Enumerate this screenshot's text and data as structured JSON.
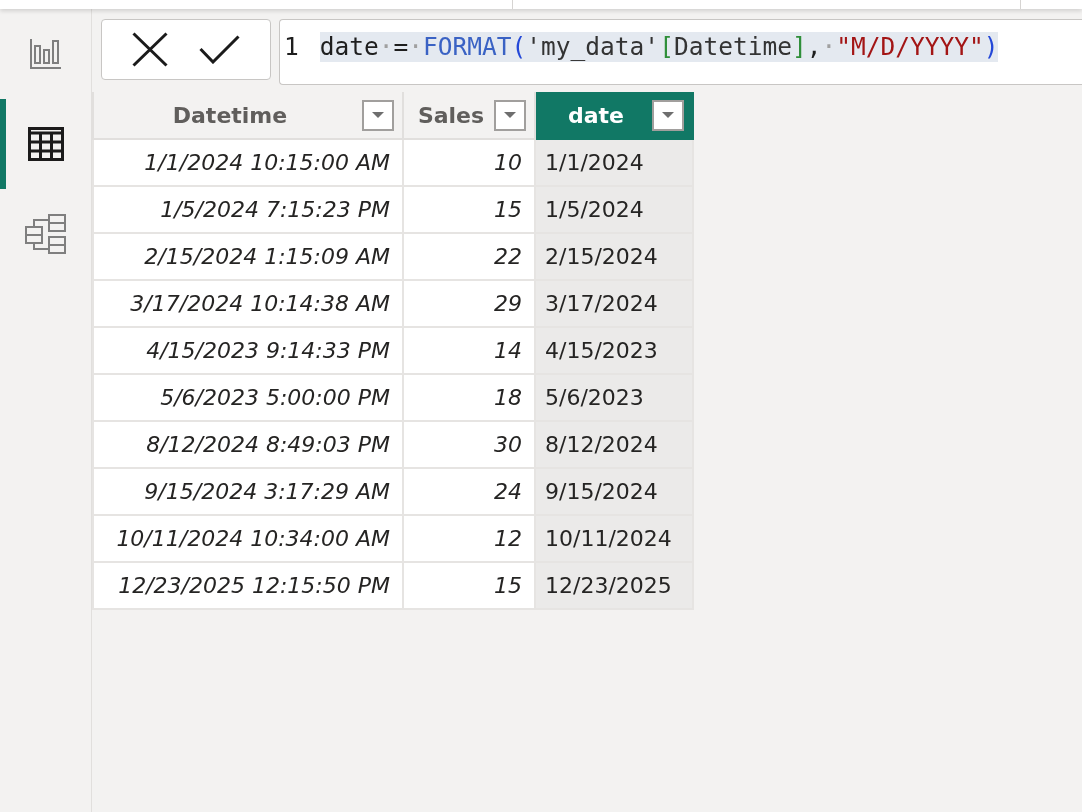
{
  "sidebar": {
    "items": [
      {
        "kind": "report",
        "selected": false
      },
      {
        "kind": "table",
        "selected": true
      },
      {
        "kind": "model",
        "selected": false
      }
    ]
  },
  "formula_bar": {
    "line_number": "1",
    "selected": true,
    "tokens": [
      {
        "kind": "identifier",
        "text": "date"
      },
      {
        "kind": "whitespace",
        "text": "·"
      },
      {
        "kind": "operator",
        "text": "="
      },
      {
        "kind": "whitespace",
        "text": "·"
      },
      {
        "kind": "function",
        "text": "FORMAT"
      },
      {
        "kind": "paren",
        "text": "("
      },
      {
        "kind": "table",
        "text": "'my_data'"
      },
      {
        "kind": "bracket",
        "text": "["
      },
      {
        "kind": "column",
        "text": "Datetime"
      },
      {
        "kind": "bracket",
        "text": "]"
      },
      {
        "kind": "punctuation",
        "text": ","
      },
      {
        "kind": "whitespace",
        "text": "·"
      },
      {
        "kind": "string",
        "text": "\"M/D/YYYY\""
      },
      {
        "kind": "paren",
        "text": ")"
      }
    ]
  },
  "table": {
    "columns": [
      {
        "name": "Datetime",
        "kind": "datetime",
        "selected": false
      },
      {
        "name": "Sales",
        "kind": "number",
        "selected": false
      },
      {
        "name": "date",
        "kind": "text",
        "selected": true
      }
    ],
    "rows": [
      [
        "1/1/2024 10:15:00 AM",
        "10",
        "1/1/2024"
      ],
      [
        "1/5/2024 7:15:23 PM",
        "15",
        "1/5/2024"
      ],
      [
        "2/15/2024 1:15:09 AM",
        "22",
        "2/15/2024"
      ],
      [
        "3/17/2024 10:14:38 AM",
        "29",
        "3/17/2024"
      ],
      [
        "4/15/2023 9:14:33 PM",
        "14",
        "4/15/2023"
      ],
      [
        "5/6/2023 5:00:00 PM",
        "18",
        "5/6/2023"
      ],
      [
        "8/12/2024 8:49:03 PM",
        "30",
        "8/12/2024"
      ],
      [
        "9/15/2024 3:17:29 AM",
        "24",
        "9/15/2024"
      ],
      [
        "10/11/2024 10:34:00 AM",
        "12",
        "10/11/2024"
      ],
      [
        "12/23/2025 12:15:50 PM",
        "15",
        "12/23/2025"
      ]
    ]
  }
}
